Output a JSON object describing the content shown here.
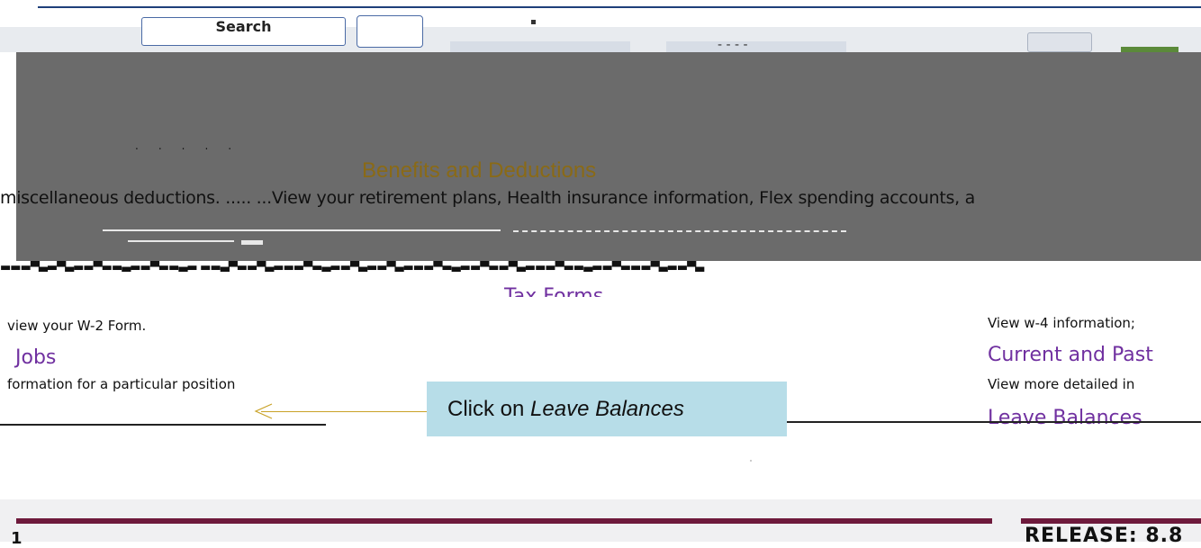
{
  "header": {
    "search_label": "Search",
    "dashes": "- - - -"
  },
  "overlay": {
    "title": "Benefits and Deductions",
    "description": "miscellaneous deductions. .....  ...View your retirement plans, Health insurance information, Flex spending accounts, a"
  },
  "main": {
    "tax_forms_link": "Tax Forms",
    "w2_text": "view your W-2 Form.",
    "jobs_link": "Jobs",
    "position_text": "formation for a particular position",
    "w4_text": "View w-4 information;",
    "current_past_link": "Current and Past",
    "detailed_text": "View more detailed in",
    "leave_balances_link": "Leave Balances"
  },
  "callout": {
    "prefix": "Click on ",
    "emphasis": "Leave Balances"
  },
  "footer": {
    "page_num": "1",
    "release": "RELEASE: 8.8"
  },
  "colors": {
    "link": "#7030a0",
    "callout_bg": "#b7dde8",
    "footer_rule": "#6e1a3c",
    "overlay": "#6b6b6b"
  }
}
